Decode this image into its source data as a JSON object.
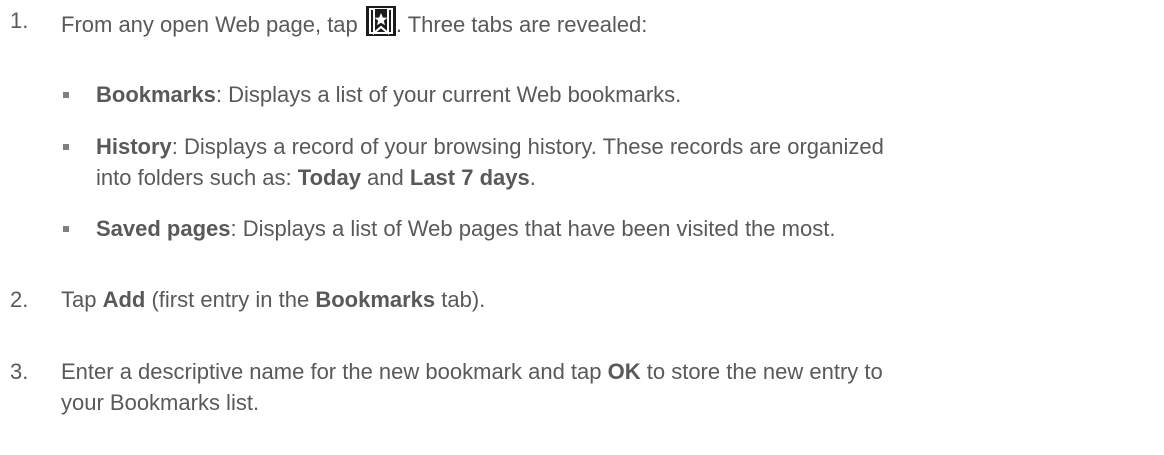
{
  "steps": [
    {
      "number": "1.",
      "text_before_icon": "From any open Web page, tap ",
      "icon": "bookmark-star-icon",
      "text_after_icon": ". Three tabs are revealed:"
    },
    {
      "number": "2.",
      "parts": [
        "Tap ",
        "Add",
        " (first entry in the ",
        "Bookmarks",
        " tab)."
      ]
    },
    {
      "number": "3.",
      "line1": [
        "Enter a descriptive name for the new bookmark and tap ",
        "OK",
        " to store the new entry to"
      ],
      "line2": "your Bookmarks list."
    }
  ],
  "tabs": [
    {
      "name": "Bookmarks",
      "description": ": Displays a list of your current Web bookmarks."
    },
    {
      "name": "History",
      "description_line1": ": Displays a record of your browsing history. These records are organized",
      "description_line2_prefix": "into folders such as: ",
      "folder1": "Today",
      "joiner": " and ",
      "folder2": "Last 7 days",
      "end": "."
    },
    {
      "name": "Saved pages",
      "description": ": Displays a list of Web pages that have been visited the most."
    }
  ]
}
